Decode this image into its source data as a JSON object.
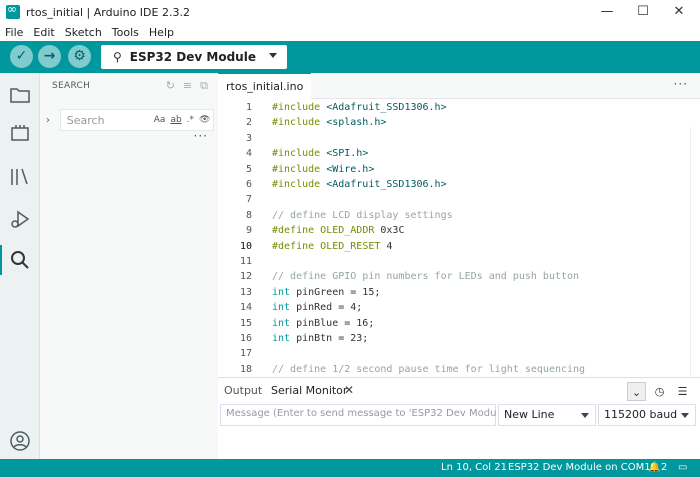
{
  "window": {
    "title": "rtos_initial | Arduino IDE 2.3.2",
    "controls": [
      "—",
      "☐",
      "✕"
    ]
  },
  "menu": [
    "File",
    "Edit",
    "Sketch",
    "Tools",
    "Help"
  ],
  "toolbar": {
    "verify_icon": "✓",
    "upload_icon": "→",
    "debug_icon": "⚙",
    "board_name": "ESP32 Dev Module",
    "usb_icon": "⚲",
    "serial_plotter_icon": "∿",
    "serial_monitor_icon": "⊙"
  },
  "sidebar": {
    "title": "SEARCH",
    "search_placeholder": "Search",
    "options": [
      "Aa",
      "ab",
      ".*",
      "👁"
    ],
    "more": "···",
    "actions": [
      "↻",
      "≡",
      "⧉"
    ]
  },
  "activity_icons": [
    "folder-icon",
    "boards-icon",
    "library-icon",
    "debug-icon",
    "search-icon",
    "account-icon"
  ],
  "tab": {
    "filename": "rtos_initial.ino",
    "more": "···"
  },
  "editor": {
    "current_line": 10,
    "lines": [
      {
        "n": "1",
        "parts": [
          [
            "pp",
            "#include "
          ],
          [
            "str",
            "<Adafruit_SSD1306.h>"
          ]
        ]
      },
      {
        "n": "2",
        "parts": [
          [
            "pp",
            "#include "
          ],
          [
            "str",
            "<splash.h>"
          ]
        ]
      },
      {
        "n": "3",
        "parts": []
      },
      {
        "n": "4",
        "parts": [
          [
            "pp",
            "#include "
          ],
          [
            "str",
            "<SPI.h>"
          ]
        ]
      },
      {
        "n": "5",
        "parts": [
          [
            "pp",
            "#include "
          ],
          [
            "str",
            "<Wire.h>"
          ]
        ]
      },
      {
        "n": "6",
        "parts": [
          [
            "pp",
            "#include "
          ],
          [
            "str",
            "<Adafruit_SSD1306.h>"
          ]
        ]
      },
      {
        "n": "7",
        "parts": []
      },
      {
        "n": "8",
        "parts": [
          [
            "cm",
            "// define LCD display settings"
          ]
        ]
      },
      {
        "n": "9",
        "parts": [
          [
            "pp",
            "#define "
          ],
          [
            "pp",
            "OLED_ADDR "
          ],
          [
            "num",
            "0x3C"
          ]
        ]
      },
      {
        "n": "10",
        "parts": [
          [
            "pp",
            "#define "
          ],
          [
            "pp",
            "OLED_RESET "
          ],
          [
            "num",
            "4"
          ]
        ]
      },
      {
        "n": "11",
        "parts": []
      },
      {
        "n": "12",
        "parts": [
          [
            "cm",
            "// define GPIO pin numbers for LEDs and push button"
          ]
        ]
      },
      {
        "n": "13",
        "parts": [
          [
            "kw",
            "int"
          ],
          [
            "txt",
            " pinGreen = 15;"
          ]
        ]
      },
      {
        "n": "14",
        "parts": [
          [
            "kw",
            "int"
          ],
          [
            "txt",
            " pinRed = 4;"
          ]
        ]
      },
      {
        "n": "15",
        "parts": [
          [
            "kw",
            "int"
          ],
          [
            "txt",
            " pinBlue = 16;"
          ]
        ]
      },
      {
        "n": "16",
        "parts": [
          [
            "kw",
            "int"
          ],
          [
            "txt",
            " pinBtn = 23;"
          ]
        ]
      },
      {
        "n": "17",
        "parts": []
      },
      {
        "n": "18",
        "parts": [
          [
            "cm",
            "// define 1/2 second pause time for light sequencing"
          ]
        ]
      }
    ]
  },
  "panel": {
    "tabs": [
      "Output",
      "Serial Monitor"
    ],
    "close": "✕",
    "buttons": [
      "⌄",
      "◷",
      "☰"
    ],
    "message_placeholder": "Message (Enter to send message to 'ESP32 Dev Modu...",
    "line_ending": "New Line",
    "baud": "115200 baud"
  },
  "status": {
    "position": "Ln 10, Col 21",
    "board_port": "ESP32 Dev Module on COM12",
    "notifications_icon": "🔔",
    "notifications": "2",
    "panel_icon": "▭"
  },
  "colors": {
    "accent": "#00979d",
    "keyword": "#00979d",
    "preprocessor": "#728e00",
    "comment": "#95a5a6"
  }
}
